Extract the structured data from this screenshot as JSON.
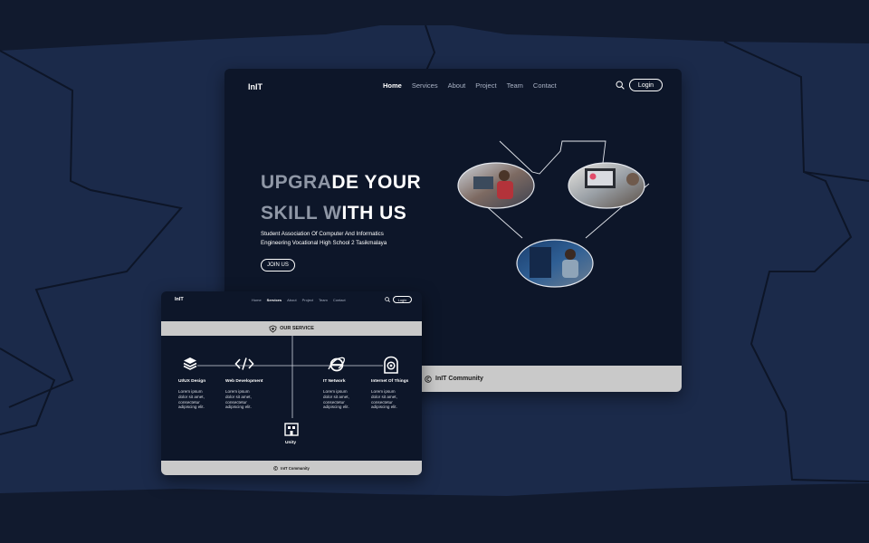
{
  "colors": {
    "background": "#1b2a4a",
    "background_dark": "#111a2e",
    "panel": "#0d1629",
    "footer_gray": "#c9c9c9",
    "text_white": "#ffffff",
    "text_dim": "#8f97a6"
  },
  "main_window": {
    "logo": "InIT",
    "nav": [
      "Home",
      "Services",
      "About",
      "Project",
      "Team",
      "Contact"
    ],
    "active_nav": "Home",
    "search_icon": "search-icon",
    "login_label": "Login",
    "hero": {
      "line1_dim": "UPGRA",
      "line1_lit": "DE YOUR",
      "line2_dim": "SKILL W",
      "line2_lit": "ITH  US",
      "subtitle_1": "Student Association  Of Computer And Informatics",
      "subtitle_2": "Engineering Vocational High School 2  Tasikmalaya"
    },
    "join_label": "JOIN US",
    "footer_icon": "copyright-icon",
    "footer_text": "InIT Community"
  },
  "small_window": {
    "logo": "InIT",
    "nav": [
      "Home",
      "Services",
      "About",
      "Project",
      "Team",
      "Contact"
    ],
    "active_nav": "Services",
    "login_label": "Login",
    "section_icon": "heart-shield-icon",
    "section_title": "OUR SERVICE",
    "services": [
      {
        "icon": "layers-icon",
        "title": "UI/UX Design",
        "desc": "Lorem ipsum dolor sit amet, consectetur adipiscing elit."
      },
      {
        "icon": "code-icon",
        "title": "Web Development",
        "desc": "Lorem ipsum dolor sit amet, consectetur adipiscing elit."
      },
      {
        "icon": "unity-icon",
        "title": "Unity",
        "desc": ""
      },
      {
        "icon": "internet-explorer-icon",
        "title": "IT Network",
        "desc": "Lorem ipsum dolor sit amet, consectetur adipiscing elit."
      },
      {
        "icon": "camera-iot-icon",
        "title": "Internet Of Things",
        "desc": "Lorem ipsum dolor sit amet, consectetur adipiscing elit."
      }
    ],
    "footer_text": "InIT Community"
  }
}
